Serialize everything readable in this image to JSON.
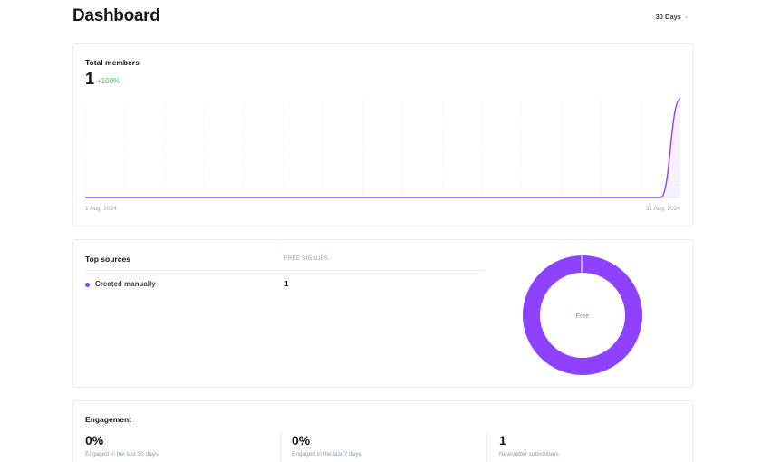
{
  "header": {
    "title": "Dashboard",
    "range_label": "30 Days"
  },
  "members": {
    "title": "Total members",
    "value": "1",
    "delta": "+100%",
    "x_start": "1 Aug, 2024",
    "x_end": "31 Aug, 2024",
    "chart_data": {
      "type": "area",
      "x": [
        "1 Aug, 2024",
        "31 Aug, 2024"
      ],
      "series": [
        {
          "values": [
            0,
            0,
            0,
            0,
            0,
            0,
            0,
            0,
            0,
            0,
            0,
            0,
            0,
            0,
            0,
            0,
            0,
            0,
            0,
            0,
            0,
            0,
            0,
            0,
            0,
            0,
            0,
            0,
            0,
            0,
            1
          ]
        }
      ],
      "color": "#8e42ff"
    }
  },
  "sources": {
    "title": "Top sources",
    "column_header": "FREE SIGNUPS",
    "rows": [
      {
        "name": "Created manually",
        "count": "1",
        "color": "#8e42ff"
      }
    ],
    "donut_label": "Free",
    "donut_color": "#8e42ff"
  },
  "engagement": {
    "title": "Engagement",
    "stats": [
      {
        "value": "0%",
        "label": "Engaged in the last 30 days"
      },
      {
        "value": "0%",
        "label": "Engaged in the last 7 days"
      },
      {
        "value": "1",
        "label": "Newsletter subscribers"
      }
    ]
  }
}
